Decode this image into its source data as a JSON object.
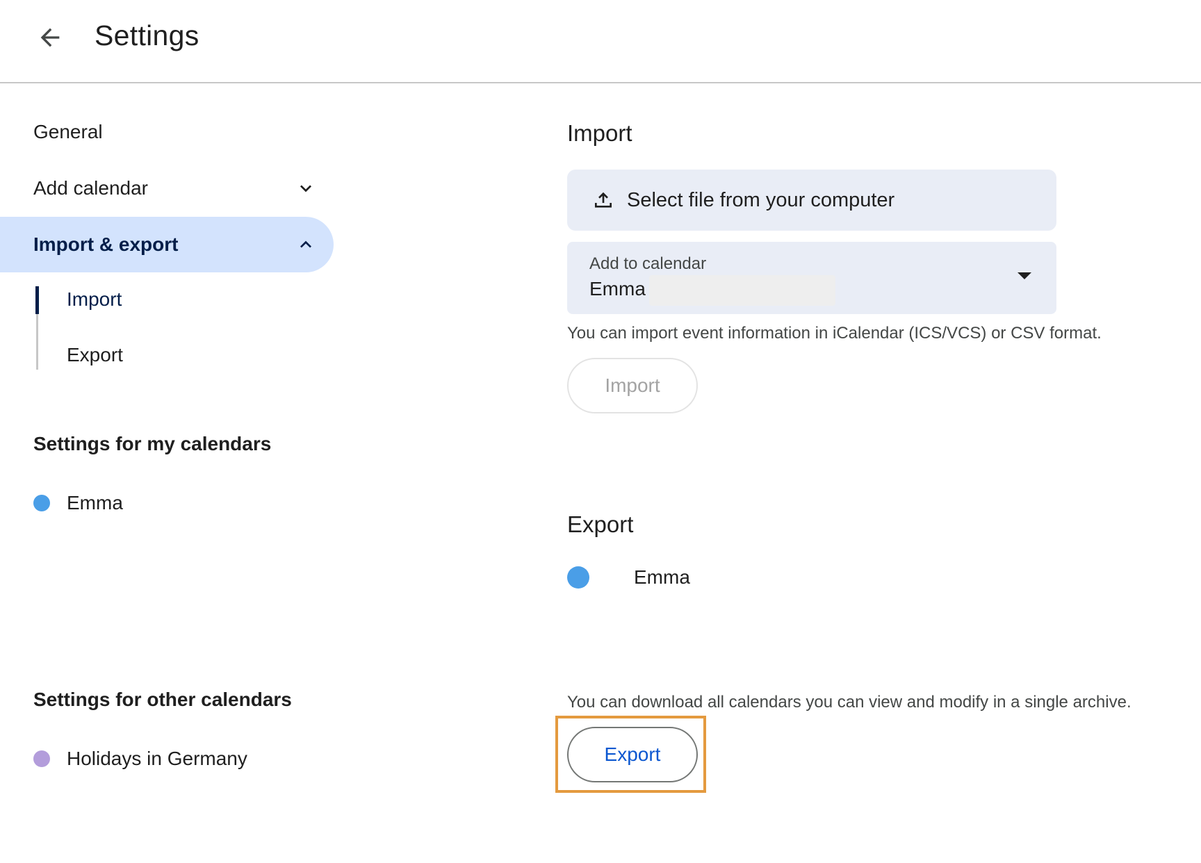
{
  "header": {
    "back_icon": "arrow-back-icon",
    "title": "Settings"
  },
  "sidebar": {
    "general": "General",
    "add_calendar": {
      "label": "Add calendar",
      "icon": "chevron-down-icon"
    },
    "import_export": {
      "label": "Import & export",
      "icon": "chevron-up-icon",
      "active": true
    },
    "sub_items": [
      {
        "label": "Import",
        "active": true
      },
      {
        "label": "Export",
        "active": false
      }
    ],
    "my_calendars": {
      "heading": "Settings for my calendars",
      "items": [
        {
          "label": "Emma",
          "color": "#4a9ee7"
        }
      ]
    },
    "other_calendars": {
      "heading": "Settings for other calendars",
      "items": [
        {
          "label": "Holidays in Germany",
          "color": "#b39ddb"
        }
      ]
    }
  },
  "import": {
    "heading": "Import",
    "file_picker": {
      "label": "Select file from your computer",
      "icon": "upload-icon"
    },
    "add_to_calendar": {
      "label": "Add to calendar",
      "value": "Emma",
      "icon": "dropdown-arrow-icon"
    },
    "helper": "You can import event information in iCalendar (ICS/VCS) or CSV format.",
    "button": {
      "label": "Import",
      "enabled": false
    }
  },
  "export": {
    "heading": "Export",
    "calendar": {
      "label": "Emma",
      "color": "#4a9ee7"
    },
    "helper": "You can download all calendars you can view and modify in a single archive.",
    "button": {
      "label": "Export",
      "enabled": true
    }
  },
  "colors": {
    "accent": "#0b57d0",
    "active_nav_bg": "#d3e3fd",
    "highlight": "#e49a3f"
  }
}
